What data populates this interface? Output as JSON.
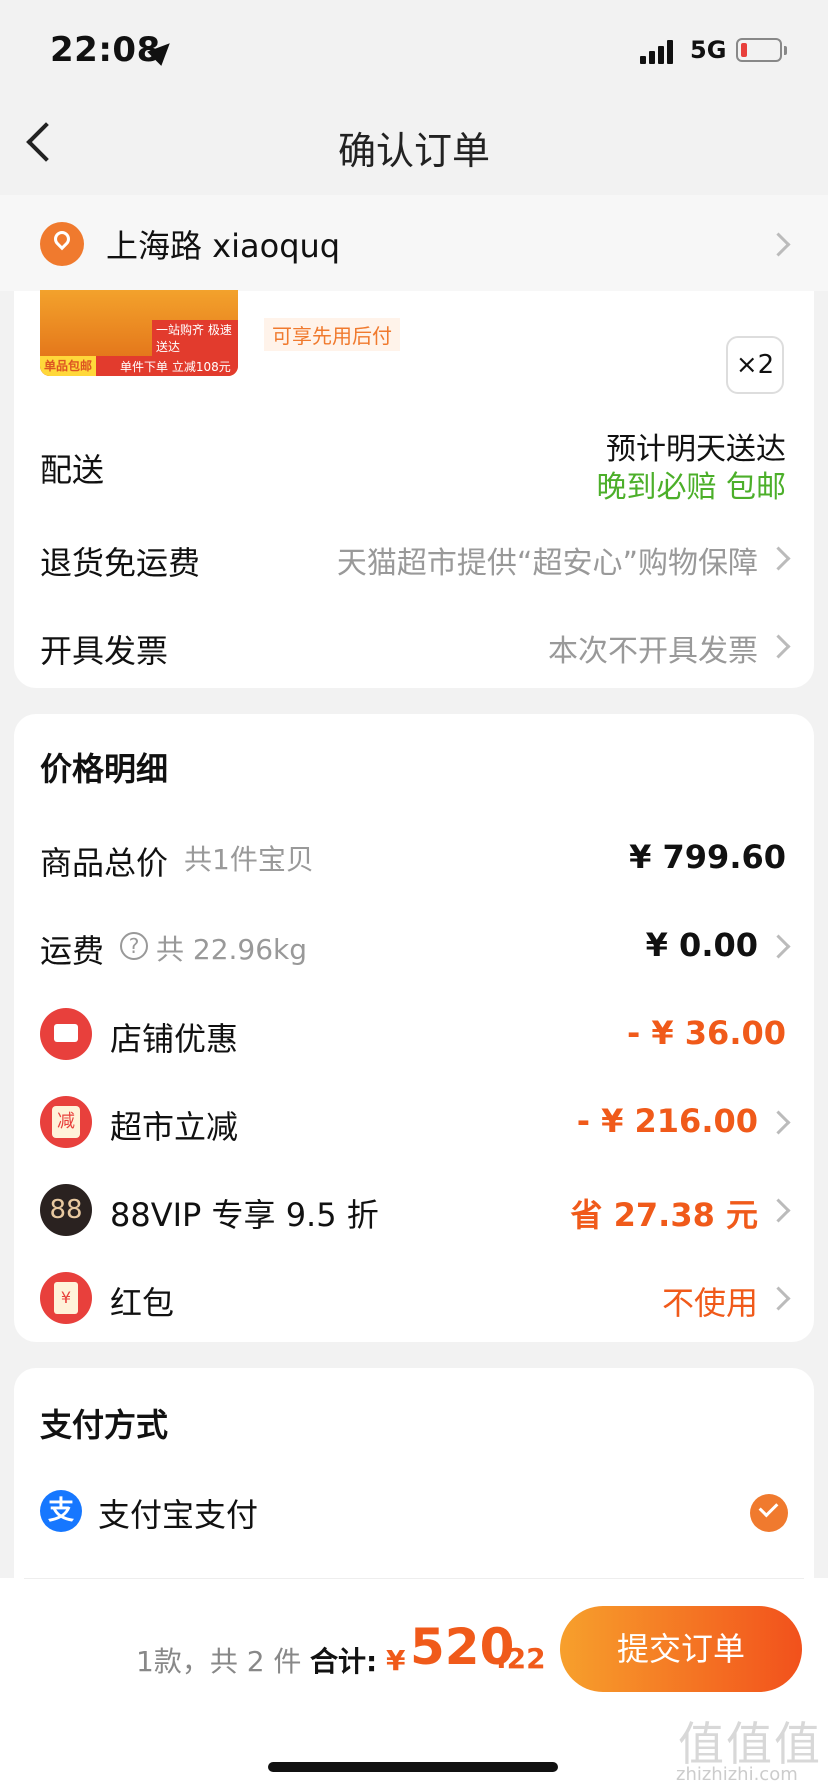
{
  "status_bar": {
    "time": "22:08",
    "network": "5G"
  },
  "nav": {
    "title": "确认订单"
  },
  "address": {
    "text": "上海路 xiaoquq"
  },
  "product": {
    "image_tag": "单品包邮",
    "image_text": "单件下单 立减108元",
    "image_text2": "一站购齐 极速送达",
    "pay_later": "可享先用后付",
    "quantity": "×2"
  },
  "delivery": {
    "label": "配送",
    "eta": "预计明天送达",
    "promise": "晚到必赔 包邮"
  },
  "returns": {
    "label": "退货免运费",
    "value": "天猫超市提供“超安心”购物保障"
  },
  "invoice": {
    "label": "开具发票",
    "value": "本次不开具发票"
  },
  "price": {
    "heading": "价格明细",
    "goods_label": "商品总价",
    "goods_sub": "共1件宝贝",
    "goods_value": "¥ 799.60",
    "shipping_label": "运费",
    "shipping_help": "?",
    "shipping_sub": "共 22.96kg",
    "shipping_value": "¥ 0.00",
    "store_label": "店铺优惠",
    "store_value": "- ¥ 36.00",
    "market_label": "超市立减",
    "market_icon": "减",
    "market_value": "- ¥ 216.00",
    "vip_label": "88VIP 专享 9.5 折",
    "vip_icon": "88",
    "vip_value": "省 27.38 元",
    "redpacket_label": "红包",
    "redpacket_icon": "¥",
    "redpacket_value": "不使用"
  },
  "payment": {
    "heading": "支付方式",
    "method": "支付宝支付",
    "method_icon": "支"
  },
  "footer": {
    "count": "1款，共 2 件",
    "total_label": "合计:",
    "currency": "¥",
    "total_int": "520",
    "total_dec": ".22",
    "submit": "提交订单"
  },
  "watermark": {
    "main": "值值值",
    "sub": "zhizhizhi.com"
  },
  "colors": {
    "accent": "#f05a1a",
    "green": "#4caf2a",
    "alipay": "#1677ff"
  }
}
